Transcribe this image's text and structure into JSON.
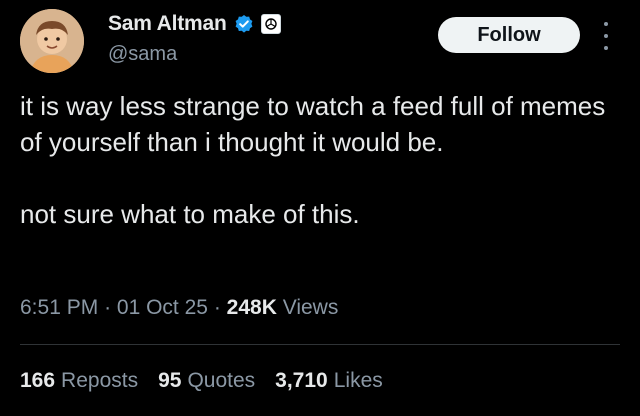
{
  "author": {
    "name": "Sam Altman",
    "handle": "@sama",
    "verified_icon": "verified-badge-icon",
    "affiliation_icon": "openai-logo-icon"
  },
  "actions": {
    "follow_label": "Follow",
    "more_icon": "more-options-icon"
  },
  "tweet": {
    "text": "it is way less strange to watch a feed full of memes of yourself than i thought it would be.\n\nnot sure what to make of this."
  },
  "meta": {
    "time": "6:51 PM",
    "separator": "·",
    "date": "01 Oct 25",
    "views_count": "248K",
    "views_label": "Views"
  },
  "stats": [
    {
      "count": "166",
      "label": "Reposts"
    },
    {
      "count": "95",
      "label": "Quotes"
    },
    {
      "count": "3,710",
      "label": "Likes"
    }
  ],
  "colors": {
    "background": "#000000",
    "text_primary": "#e7e9ea",
    "text_secondary": "#8b98a5",
    "verified_blue": "#1d9bf0",
    "follow_bg": "#eff3f4"
  }
}
